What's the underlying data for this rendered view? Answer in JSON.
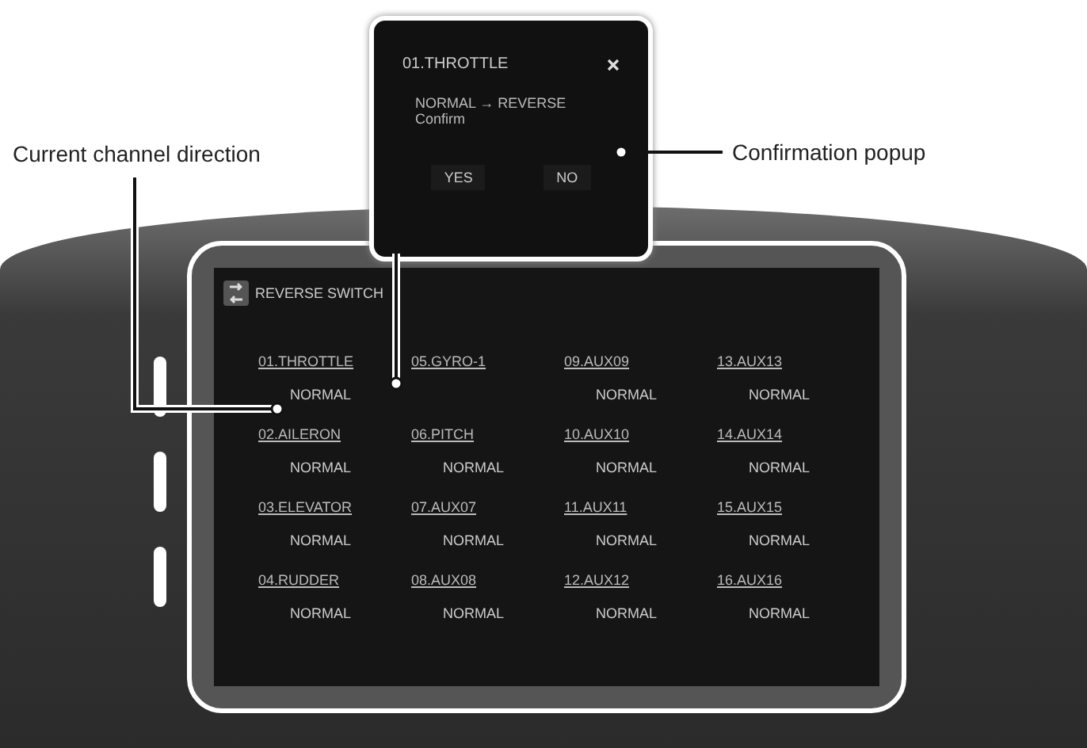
{
  "callouts": [
    {
      "label": "Current channel direction"
    },
    {
      "label": "Confirmation popup"
    }
  ],
  "popup": {
    "title": "01.THROTTLE",
    "message": "NORMAL → REVERSE",
    "prompt": "Confirm",
    "buttons": [
      "YES",
      "NO"
    ]
  },
  "screen": {
    "title": "REVERSE SWITCH",
    "channels": [
      {
        "name": "01.THROTTLE",
        "direction": "NORMAL"
      },
      {
        "name": "05.GYRO-1"
      },
      {
        "name": "09.AUX09",
        "direction": "NORMAL"
      },
      {
        "name": "13.AUX13",
        "direction": "NORMAL"
      },
      {
        "name": "02.AILERON",
        "direction": "NORMAL"
      },
      {
        "name": "06.PITCH",
        "direction": "NORMAL"
      },
      {
        "name": "10.AUX10",
        "direction": "NORMAL"
      },
      {
        "name": "14.AUX14",
        "direction": "NORMAL"
      },
      {
        "name": "03.ELEVATOR",
        "direction": "NORMAL"
      },
      {
        "name": "07.AUX07",
        "direction": "NORMAL"
      },
      {
        "name": "11.AUX11",
        "direction": "NORMAL"
      },
      {
        "name": "15.AUX15",
        "direction": "NORMAL"
      },
      {
        "name": "04.RUDDER",
        "direction": "NORMAL"
      },
      {
        "name": "08.AUX08",
        "direction": "NORMAL"
      },
      {
        "name": "12.AUX12",
        "direction": "NORMAL"
      },
      {
        "name": "16.AUX16",
        "direction": "NORMAL"
      }
    ]
  }
}
